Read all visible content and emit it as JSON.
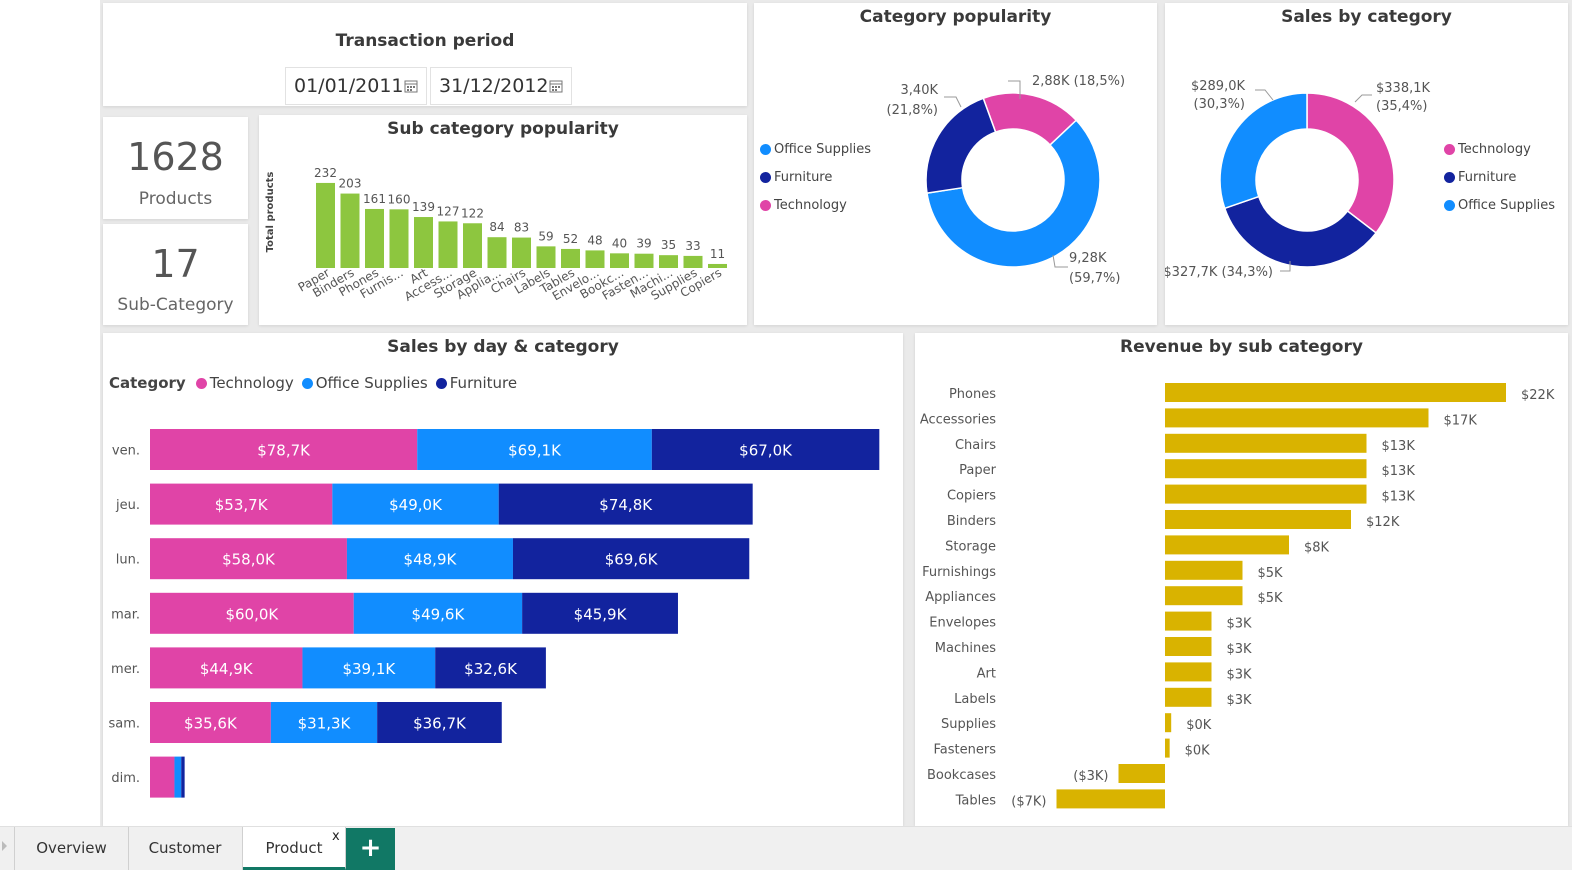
{
  "transaction_period": {
    "title": "Transaction period",
    "start_date": "01/01/2011",
    "end_date": "31/12/2012"
  },
  "kpis": [
    {
      "value": "1628",
      "label": "Products"
    },
    {
      "value": "17",
      "label": "Sub-Category"
    }
  ],
  "colors": {
    "technology": "#e044a7",
    "office_supplies": "#118dff",
    "furniture": "#12239e",
    "sub_bar": "#8dc63f",
    "revenue_bar": "#d9b300",
    "tab_accent": "#117865"
  },
  "tabs": [
    {
      "label": "Overview"
    },
    {
      "label": "Customer"
    },
    {
      "label": "Product",
      "close": "x"
    }
  ],
  "add_tab_label": "+",
  "chart_data": [
    {
      "id": "sub_category_popularity",
      "type": "bar",
      "title": "Sub category popularity",
      "ylabel": "Total products",
      "categories": [
        "Paper",
        "Binders",
        "Phones",
        "Furnis...",
        "Art",
        "Access...",
        "Storage",
        "Applia...",
        "Chairs",
        "Labels",
        "Tables",
        "Envelo...",
        "Bookc...",
        "Fasten...",
        "Machi...",
        "Supplies",
        "Copiers"
      ],
      "values": [
        232,
        203,
        161,
        160,
        139,
        127,
        122,
        84,
        83,
        59,
        52,
        48,
        40,
        39,
        35,
        33,
        11
      ],
      "ylim": [
        0,
        240
      ]
    },
    {
      "id": "category_popularity",
      "type": "pie",
      "title": "Category popularity",
      "legend": [
        "Office Supplies",
        "Furniture",
        "Technology"
      ],
      "slices": [
        {
          "name": "Technology",
          "value": 2.88,
          "label": "2,88K (18,5%)"
        },
        {
          "name": "Office Supplies",
          "value": 9.28,
          "label_line1": "9,28K",
          "label_line2": "(59,7%)"
        },
        {
          "name": "Furniture",
          "value": 3.4,
          "label_line1": "3,40K",
          "label_line2": "(21,8%)"
        }
      ]
    },
    {
      "id": "sales_by_category",
      "type": "pie",
      "title": "Sales by category",
      "legend": [
        "Technology",
        "Furniture",
        "Office Supplies"
      ],
      "slices": [
        {
          "name": "Technology",
          "value": 338.1,
          "label_line1": "$338,1K",
          "label_line2": "(35,4%)"
        },
        {
          "name": "Furniture",
          "value": 327.7,
          "label": "$327,7K (34,3%)"
        },
        {
          "name": "Office Supplies",
          "value": 289.0,
          "label_line1": "$289,0K",
          "label_line2": "(30,3%)"
        }
      ]
    },
    {
      "id": "sales_by_day_category",
      "type": "bar",
      "stacked": true,
      "orientation": "horizontal",
      "title": "Sales by day & category",
      "legend_title": "Category",
      "legend": [
        "Technology",
        "Office Supplies",
        "Furniture"
      ],
      "categories": [
        "ven.",
        "jeu.",
        "lun.",
        "mar.",
        "mer.",
        "sam.",
        "dim."
      ],
      "series": [
        {
          "name": "Technology",
          "values": [
            78.7,
            53.7,
            58.0,
            60.0,
            44.9,
            35.6,
            7.2
          ],
          "labels": [
            "$78,7K",
            "$53,7K",
            "$58,0K",
            "$60,0K",
            "$44,9K",
            "$35,6K",
            ""
          ]
        },
        {
          "name": "Office Supplies",
          "values": [
            69.1,
            49.0,
            48.9,
            49.6,
            39.1,
            31.3,
            2.0
          ],
          "labels": [
            "$69,1K",
            "$49,0K",
            "$48,9K",
            "$49,6K",
            "$39,1K",
            "$31,3K",
            ""
          ]
        },
        {
          "name": "Furniture",
          "values": [
            67.0,
            74.8,
            69.6,
            45.9,
            32.6,
            36.7,
            1.0
          ],
          "labels": [
            "$67,0K",
            "$74,8K",
            "$69,6K",
            "$45,9K",
            "$32,6K",
            "$36,7K",
            ""
          ]
        }
      ],
      "xlim": [
        0,
        215
      ]
    },
    {
      "id": "revenue_by_sub_category",
      "type": "bar",
      "orientation": "horizontal",
      "title": "Revenue by sub category",
      "categories": [
        "Phones",
        "Accessories",
        "Chairs",
        "Paper",
        "Copiers",
        "Binders",
        "Storage",
        "Furnishings",
        "Appliances",
        "Envelopes",
        "Machines",
        "Art",
        "Labels",
        "Supplies",
        "Fasteners",
        "Bookcases",
        "Tables"
      ],
      "values": [
        22,
        17,
        13,
        13,
        13,
        12,
        8,
        5,
        5,
        3,
        3,
        3,
        3,
        0.4,
        0.3,
        -3,
        -7
      ],
      "labels": [
        "$22K",
        "$17K",
        "$13K",
        "$13K",
        "$13K",
        "$12K",
        "$8K",
        "$5K",
        "$5K",
        "$3K",
        "$3K",
        "$3K",
        "$3K",
        "$0K",
        "$0K",
        "($3K)",
        "($7K)"
      ],
      "xlim": [
        -7,
        22
      ]
    }
  ]
}
